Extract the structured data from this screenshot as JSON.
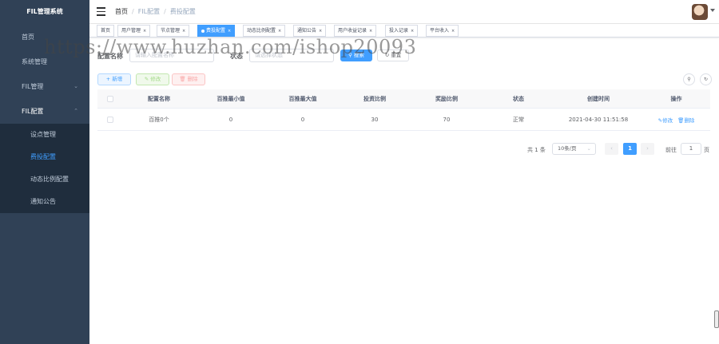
{
  "sidebar": {
    "logo": "FIL管理系统",
    "items": [
      {
        "label": "首页"
      },
      {
        "label": "系统管理"
      },
      {
        "label": "FIL管理"
      },
      {
        "label": "FIL配置"
      }
    ],
    "subitems": [
      {
        "label": "设点管理"
      },
      {
        "label": "费投配置"
      },
      {
        "label": "动态比例配置"
      },
      {
        "label": "通知公告"
      }
    ],
    "colors": {
      "bg": "#304156",
      "submenu_bg": "#1f2d3d",
      "active": "#409eff"
    }
  },
  "header": {
    "breadcrumb": [
      "首页",
      "FIL配置",
      "费投配置"
    ]
  },
  "tags": [
    {
      "label": "首页"
    },
    {
      "label": "用户管理"
    },
    {
      "label": "节点管理"
    },
    {
      "label": "费投配置"
    },
    {
      "label": "动态比例配置"
    },
    {
      "label": "通知公告"
    },
    {
      "label": "用户收益记录"
    },
    {
      "label": "投入记录"
    },
    {
      "label": "平台收入"
    }
  ],
  "search": {
    "name_label": "配置名称",
    "name_placeholder": "请输入配置名称",
    "status_label": "状态",
    "status_placeholder": "请选择状态",
    "search_button": "搜索",
    "reset_button": "重置"
  },
  "toolbar": {
    "add": "新增",
    "edit": "修改",
    "delete": "删除"
  },
  "table": {
    "columns": [
      "配置名称",
      "百推最小值",
      "百推最大值",
      "投资比例",
      "奖励比例",
      "状态",
      "创建时间",
      "操作"
    ],
    "rows": [
      {
        "name": "百推0个",
        "min": "0",
        "max": "0",
        "invest_ratio": "30",
        "reward_ratio": "70",
        "status": "正常",
        "created": "2021-04-30 11:51:58",
        "edit": "修改",
        "delete": "删除"
      }
    ]
  },
  "pagination": {
    "total": "共 1 条",
    "page_size": "10条/页",
    "current_page": "1",
    "goto_label": "前往",
    "goto_value": "1",
    "page_unit": "页"
  },
  "watermark": "https://www.huzhan.com/ishop20093"
}
